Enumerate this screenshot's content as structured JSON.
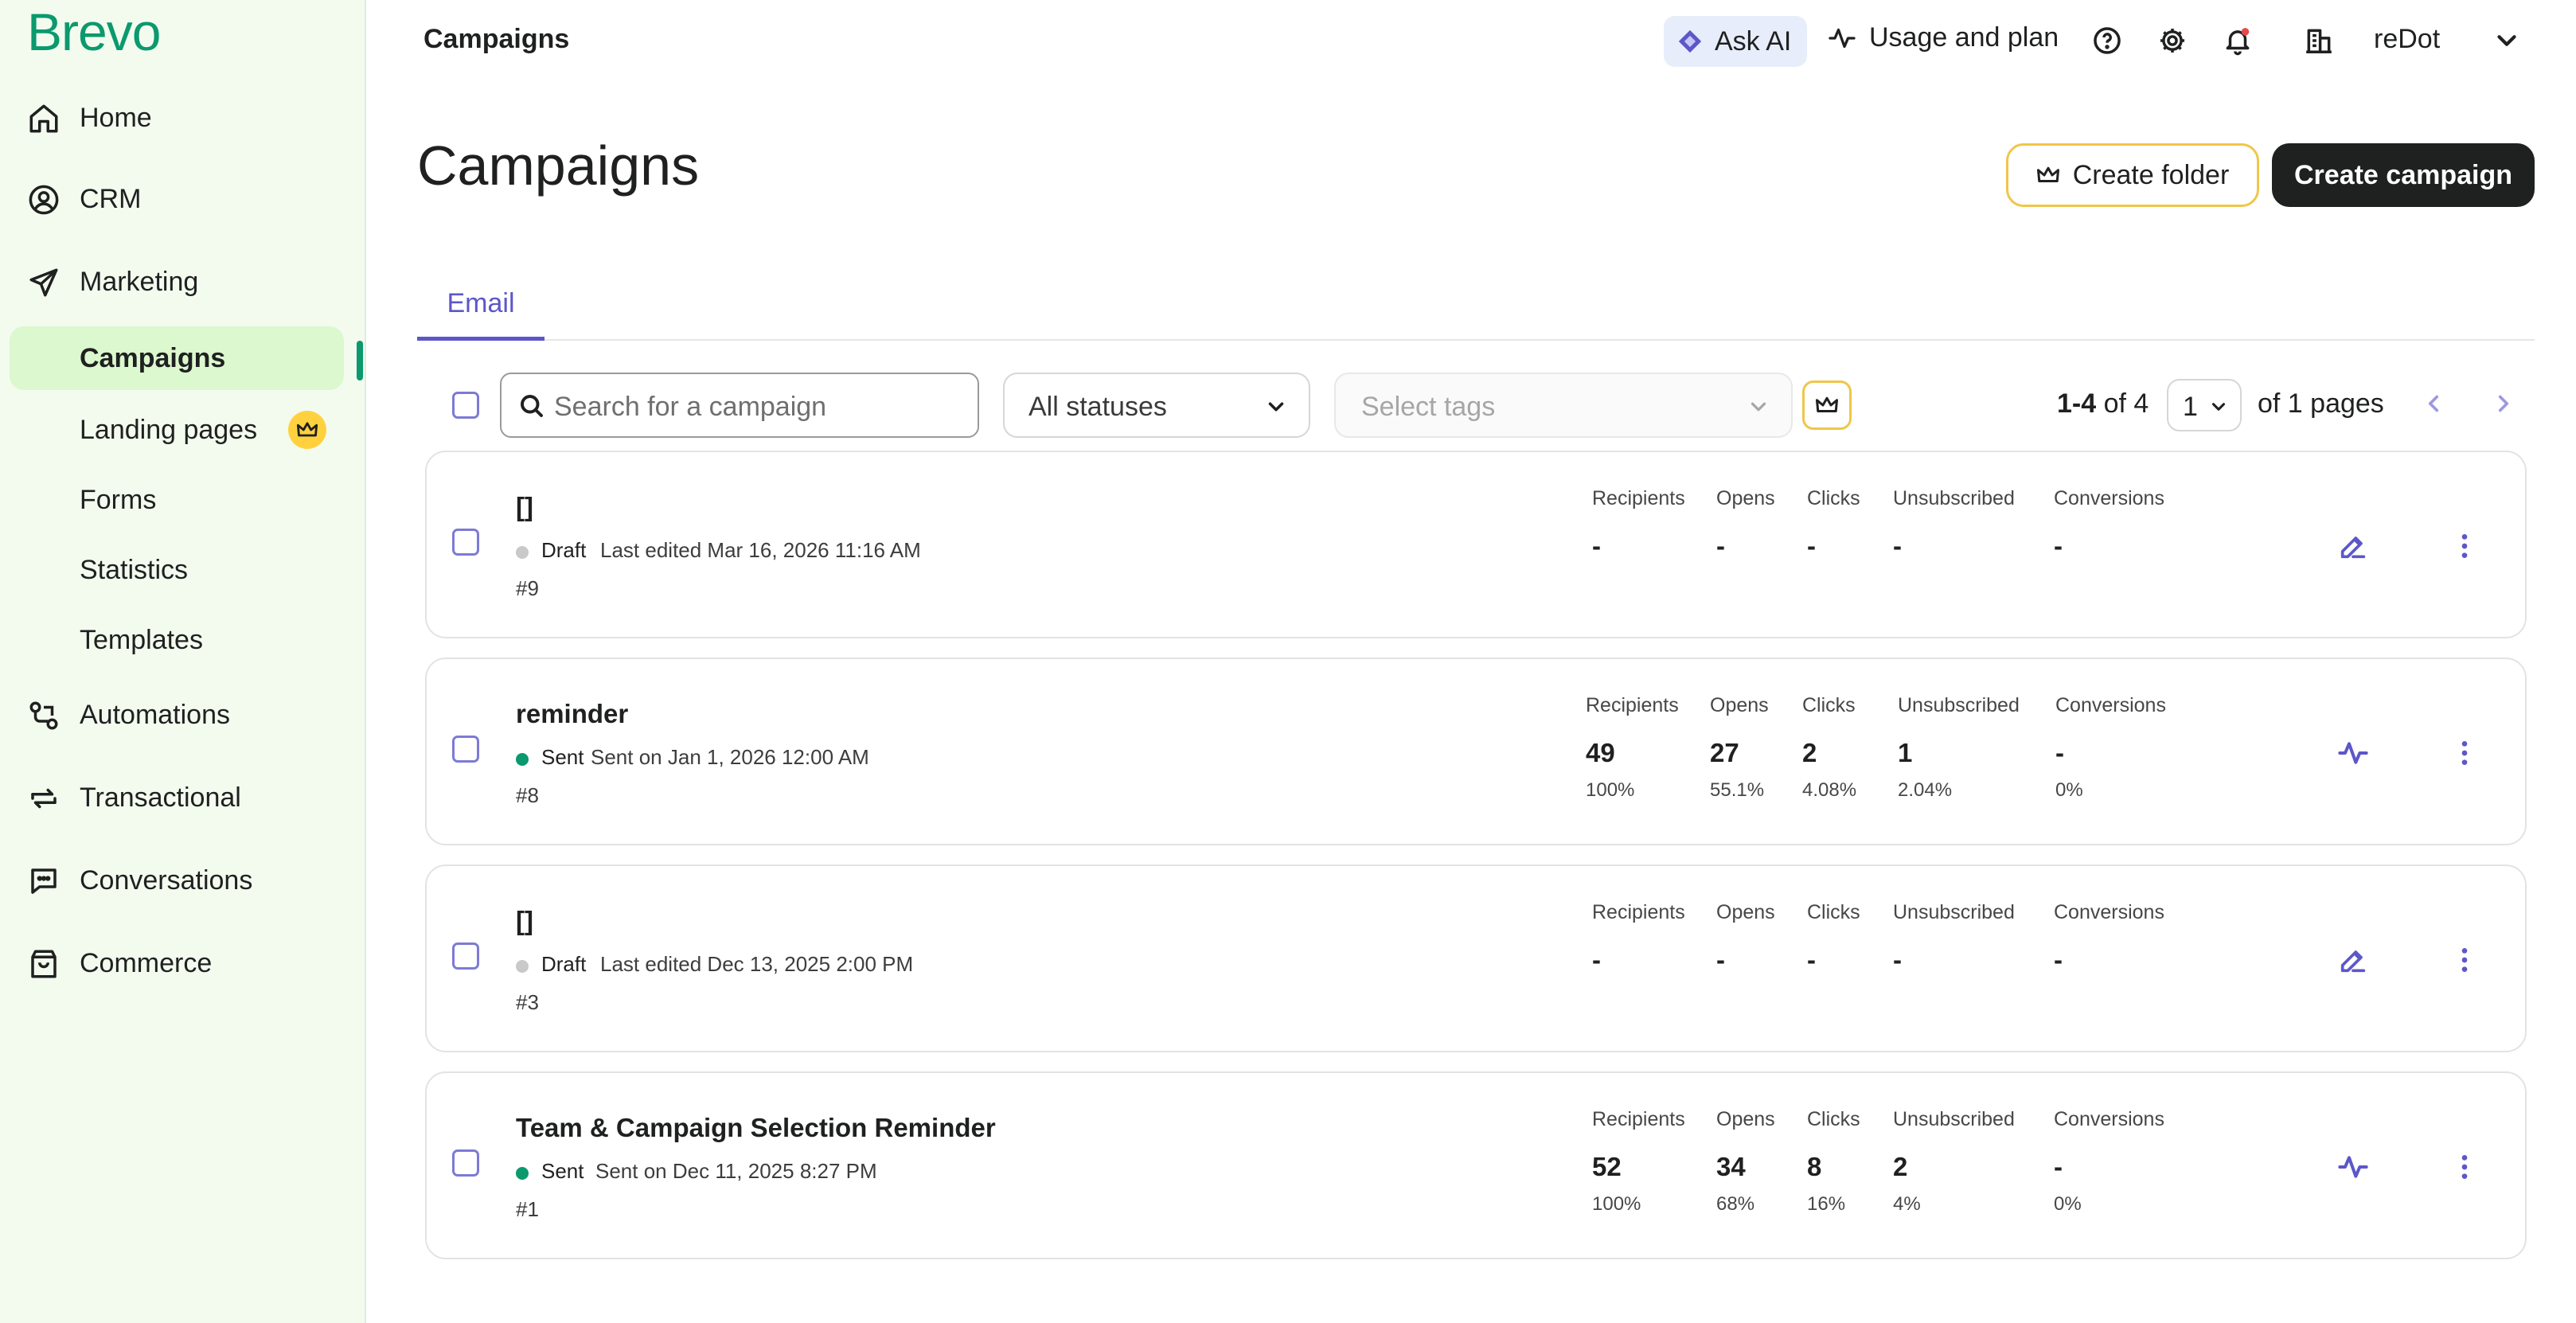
{
  "brand": {
    "logo_text": "Brevo",
    "accent": "#0b996e",
    "active_bg": "#dcf8ce",
    "link_color": "#5c57c9"
  },
  "sidebar": {
    "items": [
      {
        "label": "Home",
        "icon": "home-icon"
      },
      {
        "label": "CRM",
        "icon": "contacts-icon"
      },
      {
        "label": "Marketing",
        "icon": "paper-plane-icon"
      },
      {
        "label": "Automations",
        "icon": "automation-icon"
      },
      {
        "label": "Transactional",
        "icon": "arrows-cycle-icon"
      },
      {
        "label": "Conversations",
        "icon": "chat-bubble-icon"
      },
      {
        "label": "Commerce",
        "icon": "shopping-bag-icon"
      }
    ],
    "marketing_sub": [
      {
        "label": "Campaigns",
        "active": true
      },
      {
        "label": "Landing pages",
        "badge": "crown-icon"
      },
      {
        "label": "Forms"
      },
      {
        "label": "Statistics"
      },
      {
        "label": "Templates"
      }
    ]
  },
  "topbar": {
    "title": "Campaigns",
    "ask_ai": "Ask AI",
    "usage": "Usage and plan",
    "account": "reDot",
    "icons": [
      "help-icon",
      "gear-icon",
      "bell-icon",
      "building-icon"
    ]
  },
  "page": {
    "title": "Campaigns",
    "create_folder": "Create folder",
    "create_campaign": "Create campaign",
    "tab_email": "Email"
  },
  "filters": {
    "search_placeholder": "Search for a campaign",
    "status_value": "All statuses",
    "tags_placeholder": "Select tags"
  },
  "pager": {
    "range": "1-4",
    "of_total": "of 4",
    "page": "1",
    "of_pages": "of 1 pages"
  },
  "stat_labels": {
    "recipients": "Recipients",
    "opens": "Opens",
    "clicks": "Clicks",
    "unsubscribed": "Unsubscribed",
    "conversions": "Conversions"
  },
  "campaigns": [
    {
      "name": "[]",
      "status": "Draft",
      "status_color": "#c9c9c9",
      "date": "Last edited Mar 16, 2026 11:16 AM",
      "id": "#9",
      "recipients": {
        "value": "-",
        "pct": ""
      },
      "opens": {
        "value": "-",
        "pct": ""
      },
      "clicks": {
        "value": "-",
        "pct": ""
      },
      "unsubscribed": {
        "value": "-",
        "pct": ""
      },
      "conversions": {
        "value": "-",
        "pct": ""
      },
      "action_icon": "pencil-icon"
    },
    {
      "name": "reminder",
      "status": "Sent",
      "status_color": "#0b996e",
      "date": "Sent on Jan 1, 2026 12:00 AM",
      "id": "#8",
      "recipients": {
        "value": "49",
        "pct": "100%"
      },
      "opens": {
        "value": "27",
        "pct": "55.1%"
      },
      "clicks": {
        "value": "2",
        "pct": "4.08%"
      },
      "unsubscribed": {
        "value": "1",
        "pct": "2.04%"
      },
      "conversions": {
        "value": "-",
        "pct": "0%"
      },
      "action_icon": "activity-icon"
    },
    {
      "name": "[]",
      "status": "Draft",
      "status_color": "#c9c9c9",
      "date": "Last edited Dec 13, 2025 2:00 PM",
      "id": "#3",
      "recipients": {
        "value": "-",
        "pct": ""
      },
      "opens": {
        "value": "-",
        "pct": ""
      },
      "clicks": {
        "value": "-",
        "pct": ""
      },
      "unsubscribed": {
        "value": "-",
        "pct": ""
      },
      "conversions": {
        "value": "-",
        "pct": ""
      },
      "action_icon": "pencil-icon"
    },
    {
      "name": "Team & Campaign Selection Reminder",
      "status": "Sent",
      "status_color": "#0b996e",
      "date": "Sent on Dec 11, 2025 8:27 PM",
      "id": "#1",
      "recipients": {
        "value": "52",
        "pct": "100%"
      },
      "opens": {
        "value": "34",
        "pct": "68%"
      },
      "clicks": {
        "value": "8",
        "pct": "16%"
      },
      "unsubscribed": {
        "value": "2",
        "pct": "4%"
      },
      "conversions": {
        "value": "-",
        "pct": "0%"
      },
      "action_icon": "activity-icon"
    }
  ]
}
